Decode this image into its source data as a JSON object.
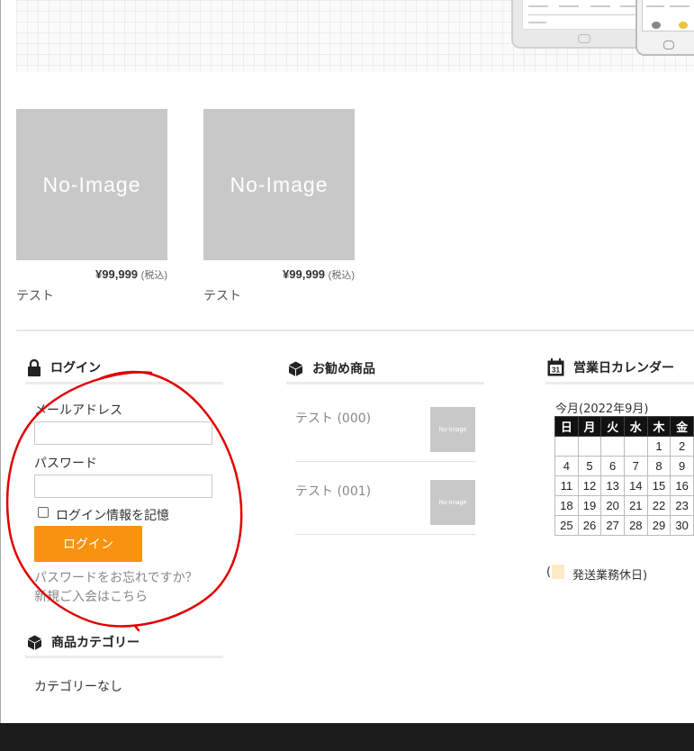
{
  "products": [
    {
      "image_text": "No-Image",
      "price": "¥99,999",
      "tax": "(税込)",
      "name": "テスト"
    },
    {
      "image_text": "No-Image",
      "price": "¥99,999",
      "tax": "(税込)",
      "name": "テスト"
    }
  ],
  "login": {
    "heading": "ログイン",
    "email_label": "メールアドレス",
    "email_value": "",
    "password_label": "パスワード",
    "password_value": "",
    "remember_label": "ログイン情報を記憶",
    "remember_checked": false,
    "submit_label": "ログイン",
    "forgot_link": "パスワードをお忘れですか？",
    "register_link": "新規ご入会はこちら"
  },
  "category": {
    "heading": "商品カテゴリー",
    "empty_text": "カテゴリーなし"
  },
  "recommended": {
    "heading": "お勧め商品",
    "items": [
      {
        "name": "テスト (000)",
        "thumb_text": "No-Image"
      },
      {
        "name": "テスト (001)",
        "thumb_text": "No-Image"
      }
    ]
  },
  "calendar": {
    "heading": "営業日カレンダー",
    "icon_text": "31",
    "month_label": "今月(2022年9月)",
    "weekdays": [
      "日",
      "月",
      "火",
      "水",
      "木",
      "金"
    ],
    "weeks": [
      [
        "",
        "",
        "",
        "",
        "1",
        "2"
      ],
      [
        "4",
        "5",
        "6",
        "7",
        "8",
        "9"
      ],
      [
        "11",
        "12",
        "13",
        "14",
        "15",
        "16"
      ],
      [
        "18",
        "19",
        "20",
        "21",
        "22",
        "23"
      ],
      [
        "25",
        "26",
        "27",
        "28",
        "29",
        "30"
      ]
    ],
    "legend_open": "(",
    "legend_label": "発送業務休日)",
    "holiday_color": "#fdebc8"
  },
  "colors": {
    "accent": "#f8920f",
    "annotation": "#e00000",
    "footer": "#1c1c1c"
  }
}
